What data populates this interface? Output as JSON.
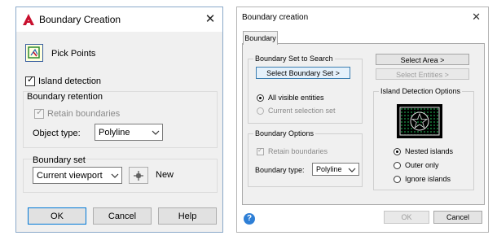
{
  "left_dialog": {
    "title": "Boundary Creation",
    "close_glyph": "✕",
    "pick_points_label": "Pick Points",
    "island_detection": {
      "label": "Island detection",
      "checked": true
    },
    "boundary_retention": {
      "header": "Boundary retention",
      "retain_boundaries": {
        "label": "Retain boundaries",
        "checked": true,
        "disabled": true
      },
      "object_type_label": "Object type:",
      "object_type_value": "Polyline"
    },
    "boundary_set": {
      "header": "Boundary set",
      "value": "Current viewport",
      "new_label": "New"
    },
    "buttons": {
      "ok": "OK",
      "cancel": "Cancel",
      "help": "Help"
    }
  },
  "right_dialog": {
    "title": "Boundary creation",
    "close_glyph": "✕",
    "tab_label": "Boundary",
    "search": {
      "header": "Boundary Set to Search",
      "select_boundary_set": "Select Boundary Set >",
      "all_visible": "All visible entities",
      "current_selection": "Current selection set"
    },
    "options": {
      "header": "Boundary Options",
      "retain_boundaries": "Retain boundaries",
      "boundary_type_label": "Boundary type:",
      "boundary_type_value": "Polyline"
    },
    "select_area": "Select Area >",
    "select_entities": "Select Entities >",
    "island": {
      "header": "Island Detection Options",
      "nested": "Nested islands",
      "outer": "Outer only",
      "ignore": "Ignore islands"
    },
    "buttons": {
      "ok": "OK",
      "cancel": "Cancel"
    }
  },
  "colors": {
    "autocad_red": "#c8102e",
    "focus_blue": "#0078d7",
    "preview_green": "#1aa34a"
  }
}
